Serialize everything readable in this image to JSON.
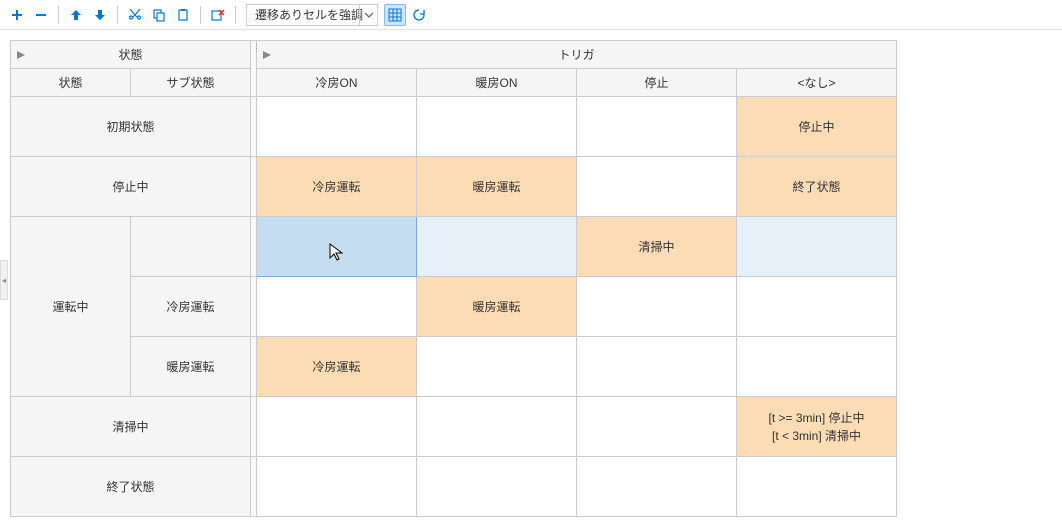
{
  "toolbar": {
    "dropdown_label": "遷移ありセルを強調"
  },
  "headers": {
    "state_group": "状態",
    "trigger_group": "トリガ",
    "state": "状態",
    "substate": "サブ状態",
    "trig_cooling_on": "冷房ON",
    "trig_heating_on": "暖房ON",
    "trig_stop": "停止",
    "trig_none": "<なし>"
  },
  "rows": {
    "initial": {
      "state": "初期状態",
      "cell_none": "停止中"
    },
    "stopped": {
      "state": "停止中",
      "cell_cooling": "冷房運転",
      "cell_heating": "暖房運転",
      "cell_none": "終了状態"
    },
    "running": {
      "state": "運転中",
      "sub_blank": {
        "cell_stop": "清掃中"
      },
      "sub_cooling": {
        "substate": "冷房運転",
        "cell_heating": "暖房運転"
      },
      "sub_heating": {
        "substate": "暖房運転",
        "cell_cooling": "冷房運転"
      }
    },
    "cleaning": {
      "state": "清掃中",
      "cell_none": "[t >= 3min] 停止中\n[t < 3min] 清掃中"
    },
    "final": {
      "state": "終了状態"
    }
  }
}
